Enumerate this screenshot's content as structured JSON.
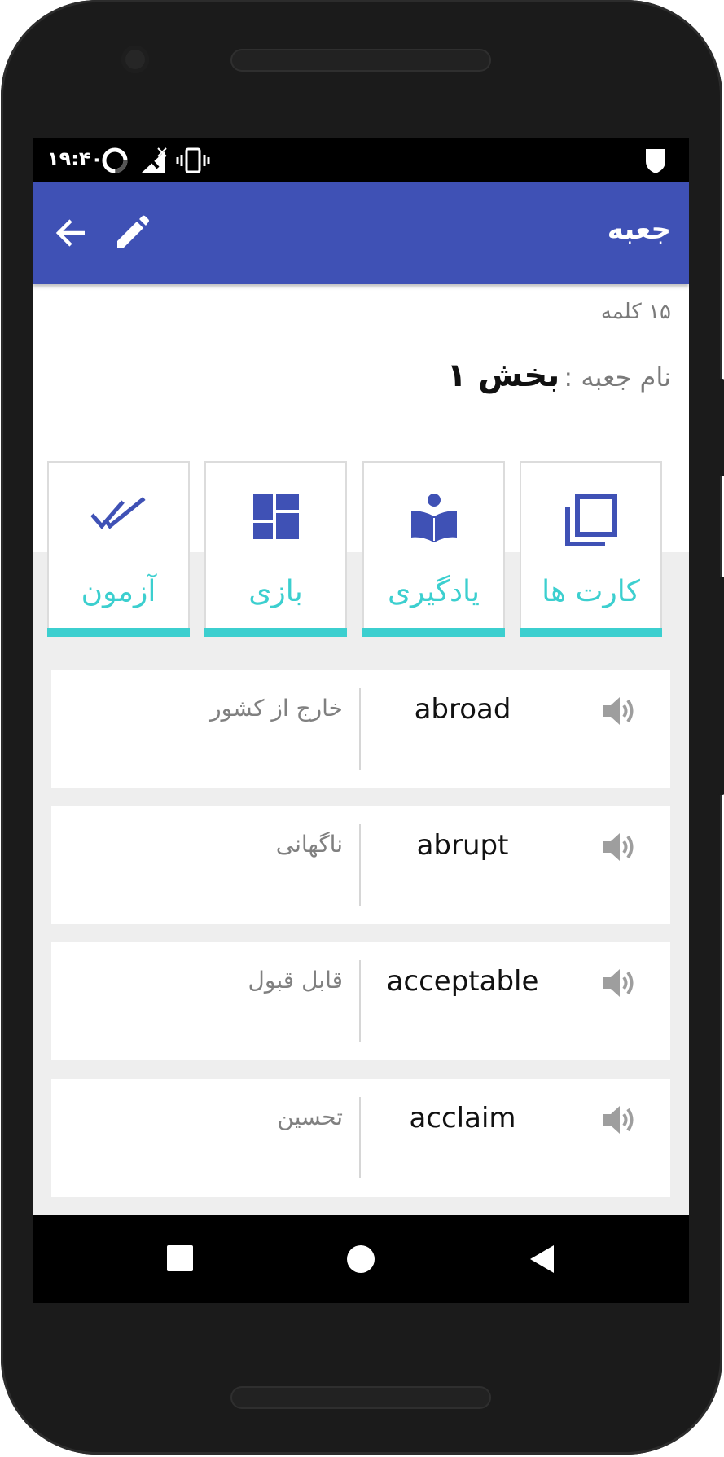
{
  "status_bar": {
    "time": "۱۹:۴۰"
  },
  "app_bar": {
    "title": "جعبه",
    "back_icon": "arrow-back-icon",
    "edit_icon": "pencil-icon"
  },
  "summary": {
    "word_count": "۱۵ کلمه",
    "box_name_label": "نام جعبه :",
    "box_name_value": "بخش ۱"
  },
  "actions": [
    {
      "label": "کارت ها",
      "icon": "cards-icon"
    },
    {
      "label": "یادگیری",
      "icon": "reading-icon"
    },
    {
      "label": "بازی",
      "icon": "dashboard-icon"
    },
    {
      "label": "آزمون",
      "icon": "double-check-icon"
    }
  ],
  "words": [
    {
      "word": "abroad",
      "meaning": "خارج از کشور"
    },
    {
      "word": "abrupt",
      "meaning": "ناگهانی"
    },
    {
      "word": "acceptable",
      "meaning": "قابل قبول"
    },
    {
      "word": "acclaim",
      "meaning": "تحسین"
    }
  ],
  "colors": {
    "primary": "#3f51b5",
    "accent": "#3ccfcf",
    "icon_blue": "#3f51b5",
    "speaker_gray": "#9e9e9e"
  }
}
